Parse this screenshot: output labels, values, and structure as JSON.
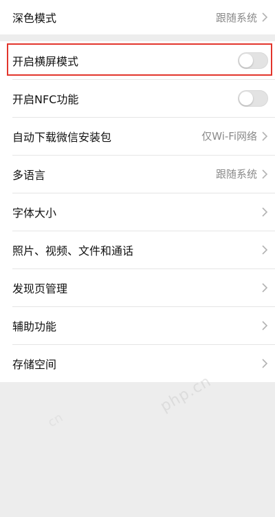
{
  "top_group": {
    "dark_mode": {
      "label": "深色模式",
      "value": "跟随系统"
    }
  },
  "settings": {
    "landscape": {
      "label": "开启横屏模式",
      "enabled": false
    },
    "nfc": {
      "label": "开启NFC功能",
      "enabled": false
    },
    "auto_download": {
      "label": "自动下载微信安装包",
      "value": "仅Wi-Fi网络"
    },
    "language": {
      "label": "多语言",
      "value": "跟随系统"
    },
    "font_size": {
      "label": "字体大小"
    },
    "media": {
      "label": "照片、视频、文件和通话"
    },
    "discover": {
      "label": "发现页管理"
    },
    "accessibility": {
      "label": "辅助功能"
    },
    "storage": {
      "label": "存储空间"
    }
  },
  "watermark": {
    "text": "php.cn",
    "text2": "cn"
  },
  "colors": {
    "highlight": "#e2342b",
    "background": "#ededed",
    "secondary_text": "#8a8a8a"
  }
}
